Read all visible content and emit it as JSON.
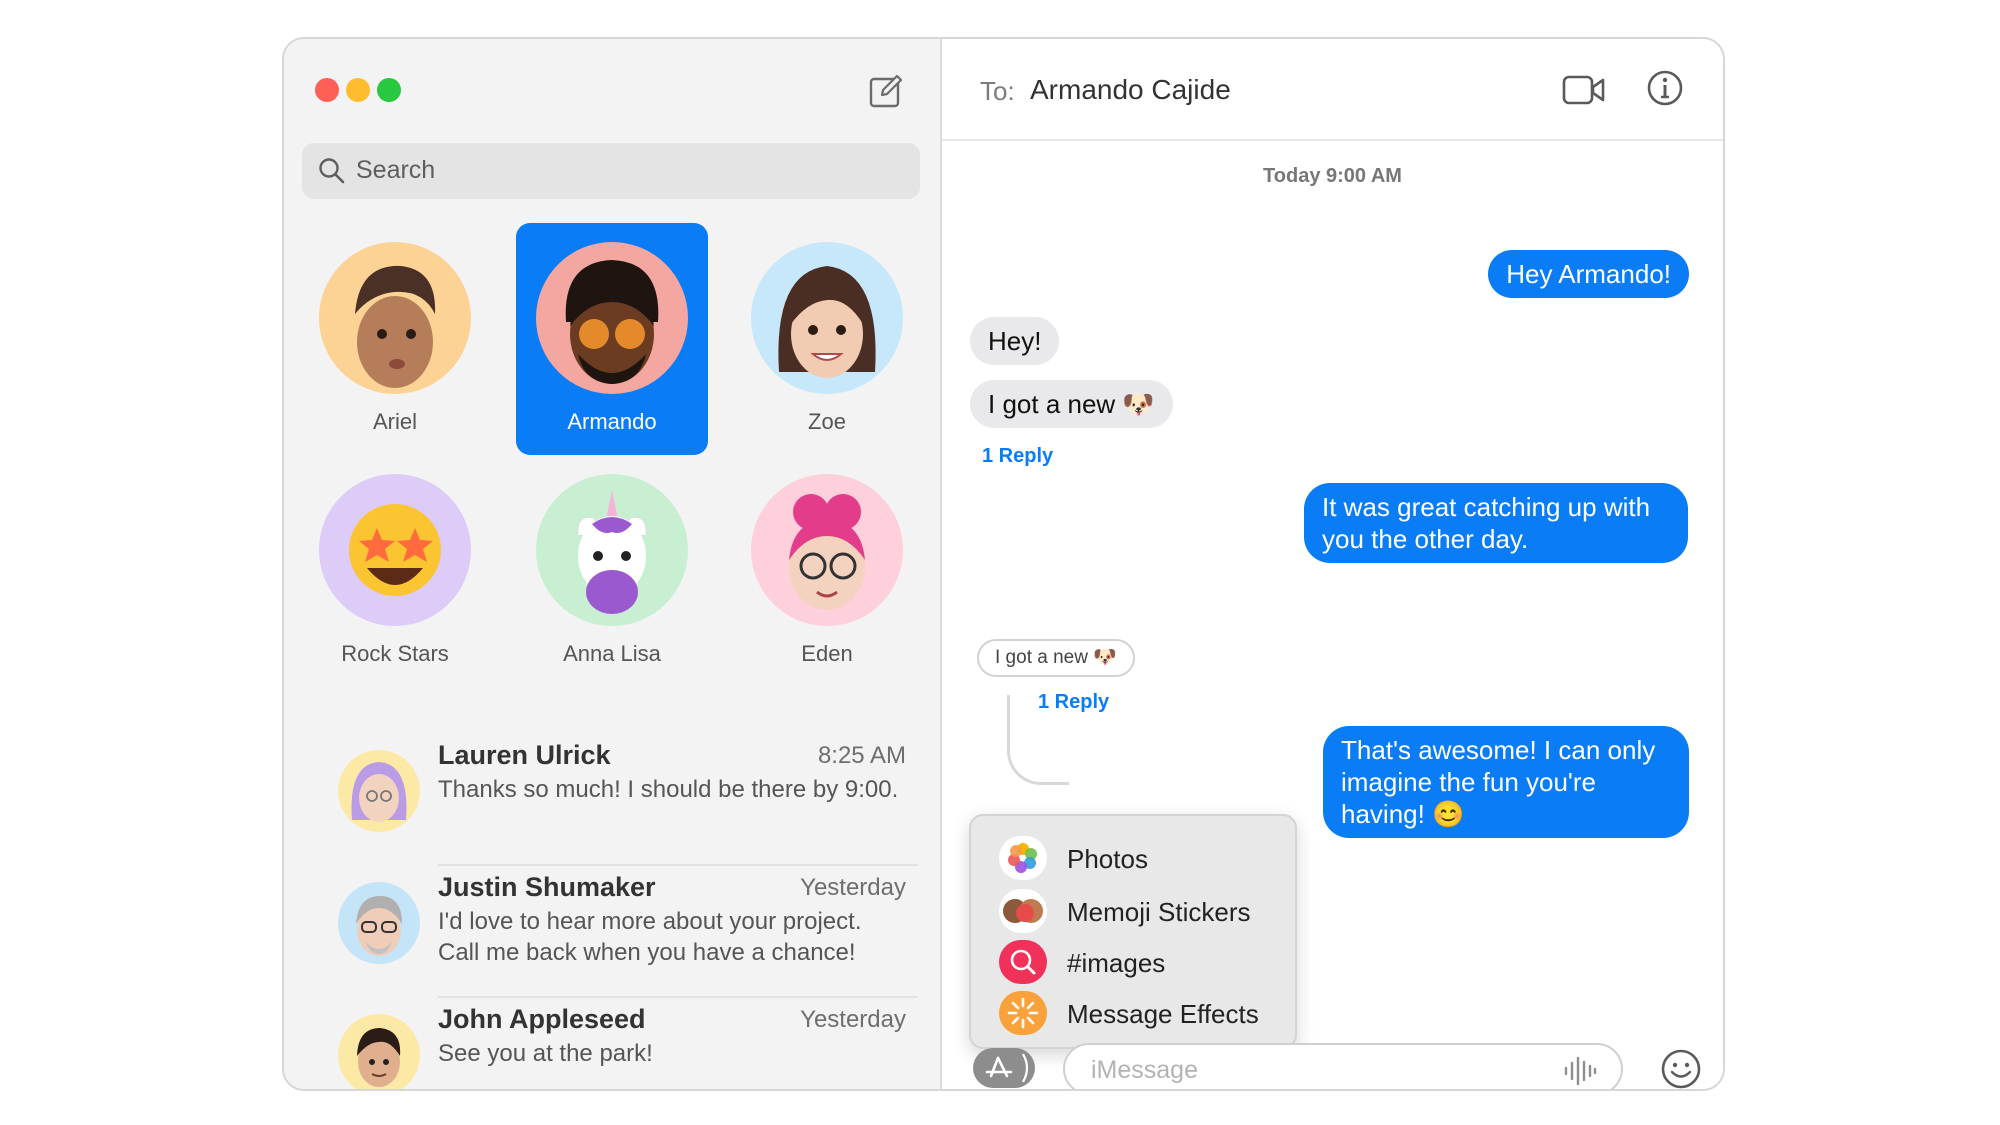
{
  "sidebar": {
    "search_placeholder": "Search",
    "pinned": [
      {
        "name": "Ariel",
        "selected": false
      },
      {
        "name": "Armando",
        "selected": true
      },
      {
        "name": "Zoe",
        "selected": false
      },
      {
        "name": "Rock Stars",
        "selected": false
      },
      {
        "name": "Anna Lisa",
        "selected": false
      },
      {
        "name": "Eden",
        "selected": false
      }
    ],
    "conversations": [
      {
        "name": "Lauren Ulrick",
        "time": "8:25 AM",
        "preview": "Thanks so much! I should be there by 9:00."
      },
      {
        "name": "Justin Shumaker",
        "time": "Yesterday",
        "preview": "I'd love to hear more about your project. Call me back when you have a chance!"
      },
      {
        "name": "John Appleseed",
        "time": "Yesterday",
        "preview": "See you at the park!"
      }
    ]
  },
  "header": {
    "to_label": "To:",
    "recipient": "Armando Cajide"
  },
  "chat": {
    "timestamp": "Today 9:00 AM",
    "messages": [
      {
        "from": "me",
        "text": "Hey Armando!"
      },
      {
        "from": "them",
        "text": "Hey!"
      },
      {
        "from": "them",
        "text": "I got a new 🐶"
      },
      {
        "from": "me",
        "text": "It was great catching up with you the other day."
      },
      {
        "from": "me",
        "text": "That's awesome! I can only imagine the fun you're having! 😊"
      }
    ],
    "reply_count_1": "1 Reply",
    "quoted_text": "I got a new 🐶",
    "reply_count_2": "1 Reply"
  },
  "app_menu": {
    "items": [
      {
        "label": "Photos",
        "icon": "photos-icon"
      },
      {
        "label": "Memoji Stickers",
        "icon": "memoji-icon"
      },
      {
        "label": "#images",
        "icon": "images-search-icon"
      },
      {
        "label": "Message Effects",
        "icon": "effects-icon"
      }
    ]
  },
  "composer": {
    "placeholder": "iMessage"
  },
  "colors": {
    "accent": "#0a7cf5",
    "incoming_bubble": "#e9e9eb",
    "close": "#fe5f57",
    "minimize": "#febc2e",
    "zoom": "#28c840"
  }
}
